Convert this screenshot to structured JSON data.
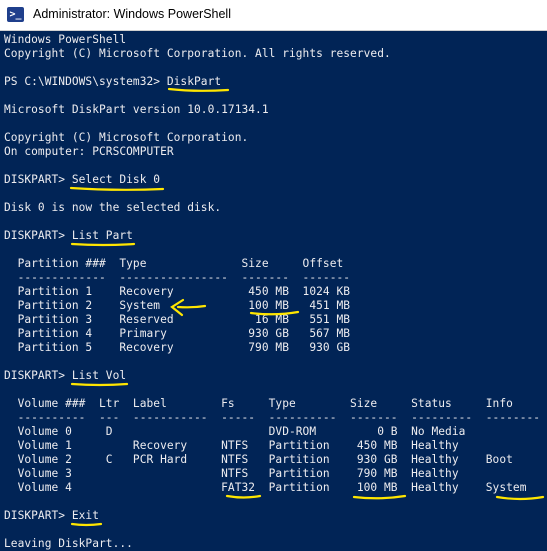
{
  "window": {
    "title": "Administrator: Windows PowerShell",
    "icon": "powershell-icon"
  },
  "colors": {
    "background": "#012456",
    "text": "#eeedf0",
    "highlight": "#ffe600"
  },
  "console": {
    "lines": [
      "Windows PowerShell",
      "Copyright (C) Microsoft Corporation. All rights reserved.",
      "",
      "PS C:\\WINDOWS\\system32> DiskPart",
      "",
      "Microsoft DiskPart version 10.0.17134.1",
      "",
      "Copyright (C) Microsoft Corporation.",
      "On computer: PCRSCOMPUTER",
      "",
      "DISKPART> Select Disk 0",
      "",
      "Disk 0 is now the selected disk.",
      "",
      "DISKPART> List Part",
      "",
      "  Partition ###  Type              Size     Offset",
      "  -------------  ----------------  -------  -------",
      "  Partition 1    Recovery           450 MB  1024 KB",
      "  Partition 2    System             100 MB   451 MB",
      "  Partition 3    Reserved            16 MB   551 MB",
      "  Partition 4    Primary            930 GB   567 MB",
      "  Partition 5    Recovery           790 MB   930 GB",
      "",
      "DISKPART> List Vol",
      "",
      "  Volume ###  Ltr  Label        Fs     Type        Size     Status     Info",
      "  ----------  ---  -----------  -----  ----------  -------  ---------  --------",
      "  Volume 0     D                       DVD-ROM         0 B  No Media",
      "  Volume 1         Recovery     NTFS   Partition    450 MB  Healthy",
      "  Volume 2     C   PCR Hard     NTFS   Partition    930 GB  Healthy    Boot",
      "  Volume 3                      NTFS   Partition    790 MB  Healthy",
      "  Volume 4                      FAT32  Partition    100 MB  Healthy    System",
      "",
      "DISKPART> Exit",
      "",
      "Leaving DiskPart..."
    ]
  }
}
